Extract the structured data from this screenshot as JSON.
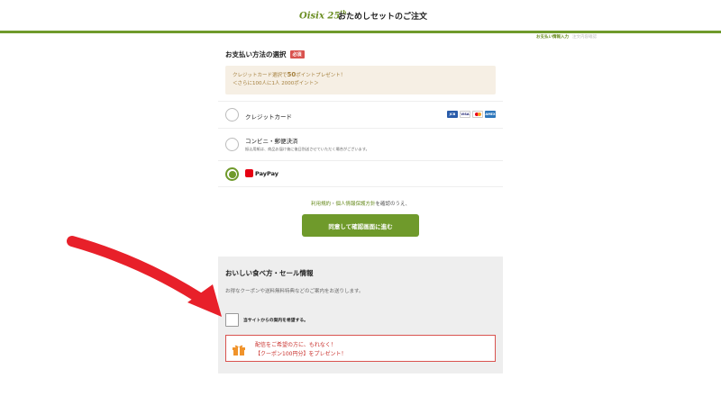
{
  "header": {
    "logo_text": "Oisix",
    "logo_number": "25",
    "logo_sup": "th",
    "title": "おためしセットのご注文"
  },
  "steps": {
    "current": "お支払い情報入力",
    "next": "注文内容確認"
  },
  "payment": {
    "section_title": "お支払い方法の選択",
    "required_badge": "必須",
    "promo_line1_prefix": "クレジットカード選択で",
    "promo_line1_highlight": "50",
    "promo_line1_suffix": "ポイントプレゼント！",
    "promo_line2": "＜さらに100人に1人 2000ポイント＞",
    "options": [
      {
        "label": "クレジットカード",
        "selected": false
      },
      {
        "label": "コンビニ・郵便決済",
        "note": "振込用紙は、商品お届け後に後日別送させていただく場合がございます。",
        "selected": false
      },
      {
        "label": "PayPay",
        "selected": true
      }
    ],
    "card_brands": [
      "JCB",
      "VISA",
      "MC",
      "AMEX"
    ]
  },
  "terms": {
    "link1": "利用規約",
    "sep": "・",
    "link2": "個人情報保護方針",
    "suffix": "を確認のうえ、"
  },
  "confirm_button": "同意して確認画面に進む",
  "sale": {
    "title": "おいしい食べ方・セール情報",
    "description": "お得なクーポンや送料無料特典などのご案内をお送りします。",
    "checkbox_label": "当サイトからの案内を希望する。",
    "gift_line1": "配信をご希望の方に、もれなく！",
    "gift_line2": "【クーポン100円分】をプレゼント！"
  },
  "colors": {
    "brand_green": "#6f9a2b",
    "promo_bg": "#f6efe4",
    "accent_red": "#d9534f",
    "annotation_arrow": "#e8202a"
  }
}
